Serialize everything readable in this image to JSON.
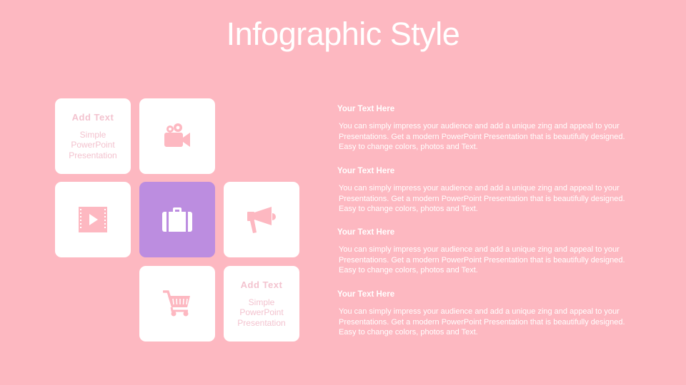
{
  "title": "Infographic Style",
  "colors": {
    "background": "#fdb8c1",
    "tile": "#ffffff",
    "tile_accent": "#bc8de0",
    "icon": "#fdb8c1",
    "icon_on_accent": "#ffffff",
    "text_light": "#ffffff"
  },
  "tiles": [
    {
      "type": "text",
      "heading": "Add Text",
      "body": "Simple PowerPoint Presentation"
    },
    {
      "type": "icon",
      "icon": "video-camera-icon"
    },
    {
      "type": "icon",
      "icon": "film-play-icon"
    },
    {
      "type": "icon",
      "icon": "briefcase-icon",
      "accent": true
    },
    {
      "type": "icon",
      "icon": "megaphone-icon"
    },
    {
      "type": "icon",
      "icon": "shopping-cart-icon"
    },
    {
      "type": "text",
      "heading": "Add Text",
      "body": "Simple PowerPoint Presentation"
    }
  ],
  "blocks": [
    {
      "title": "Your Text Here",
      "body": "You can simply impress your audience and add a unique zing and appeal to your Presentations. Get a modern PowerPoint Presentation that is beautifully designed. Easy to change colors, photos and Text."
    },
    {
      "title": "Your Text Here",
      "body": "You can simply impress your audience and add a unique zing and appeal to your Presentations. Get a modern PowerPoint Presentation that is beautifully designed. Easy to change colors, photos and Text."
    },
    {
      "title": "Your Text Here",
      "body": "You can simply impress your audience and add a unique zing and appeal to your Presentations. Get a modern PowerPoint Presentation that is beautifully designed. Easy to change colors, photos and Text."
    },
    {
      "title": "Your Text Here",
      "body": "You can simply impress your audience and add a unique zing and appeal to your Presentations. Get a modern PowerPoint Presentation that is beautifully designed. Easy to change colors, photos and Text."
    }
  ]
}
